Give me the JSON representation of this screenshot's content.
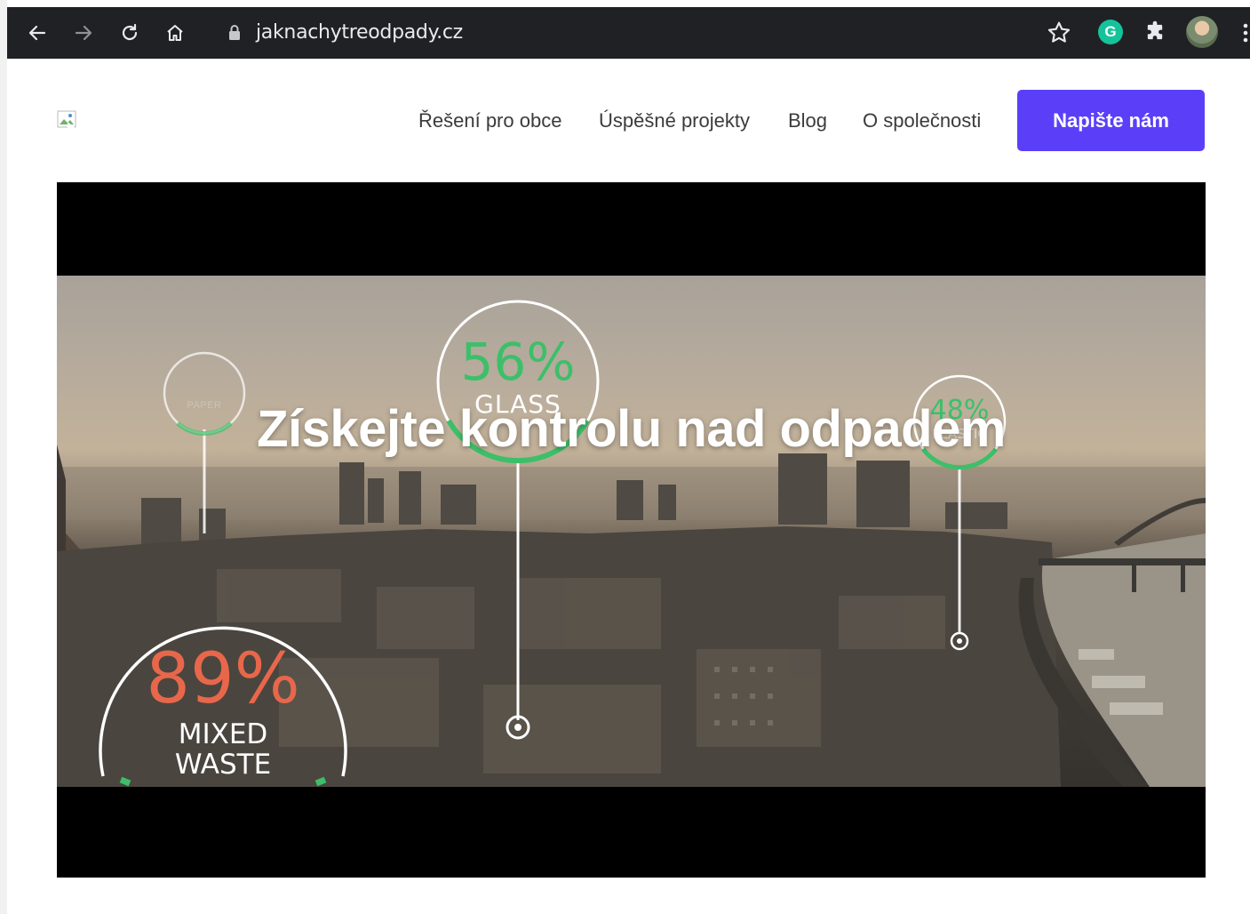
{
  "browser": {
    "url": "jaknachytreodpady.cz",
    "extension_letter": "G"
  },
  "nav": {
    "items": [
      {
        "label": "Řešení pro obce"
      },
      {
        "label": "Úspěšné projekty"
      },
      {
        "label": "Blog"
      },
      {
        "label": "O společnosti"
      }
    ],
    "cta_label": "Napište nám"
  },
  "hero": {
    "headline": "Získejte kontrolu nad odpadem",
    "badges": [
      {
        "value": "56%",
        "label": "GLASS"
      },
      {
        "value": "48%",
        "label": "PLASTIC"
      },
      {
        "value": "89%",
        "label": "MIXED WASTE"
      },
      {
        "value": "",
        "label": "PAPER"
      }
    ]
  },
  "colors": {
    "cta": "#5b3ff8",
    "badge_green": "#3dbf6a",
    "badge_red": "#e8674a",
    "chrome_bg": "#202124"
  }
}
